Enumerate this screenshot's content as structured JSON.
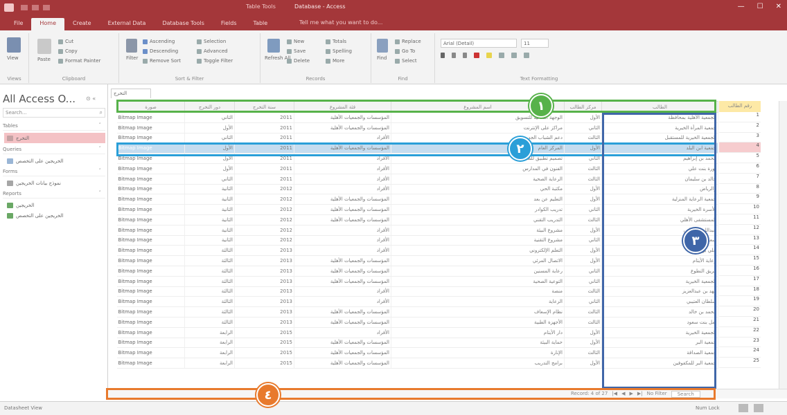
{
  "window": {
    "context_tab_group": "Table Tools",
    "title": "Database - Access",
    "minimize_glyph": "—",
    "maximize_glyph": "☐",
    "close_glyph": "✕"
  },
  "ribbon_tabs": [
    "File",
    "Home",
    "Create",
    "External Data",
    "Database Tools",
    "Fields",
    "Table"
  ],
  "tell_me": "Tell me what you want to do...",
  "ribbon": {
    "views": {
      "view": "View",
      "group": "Views"
    },
    "clipboard": {
      "paste": "Paste",
      "cut": "Cut",
      "copy": "Copy",
      "format_painter": "Format Painter",
      "group": "Clipboard"
    },
    "sort_filter": {
      "filter": "Filter",
      "ascending": "Ascending",
      "descending": "Descending",
      "remove_sort": "Remove Sort",
      "selection": "Selection",
      "advanced": "Advanced",
      "toggle_filter": "Toggle Filter",
      "group": "Sort & Filter"
    },
    "records": {
      "refresh": "Refresh All",
      "new": "New",
      "save": "Save",
      "delete": "Delete",
      "totals": "Totals",
      "spelling": "Spelling",
      "more": "More",
      "group": "Records"
    },
    "find": {
      "find": "Find",
      "replace": "Replace",
      "go_to": "Go To",
      "select": "Select",
      "group": "Find"
    },
    "text_formatting": {
      "font": "Arial (Detail)",
      "size": "11",
      "group": "Text Formatting"
    }
  },
  "nav": {
    "title": "All Access O...",
    "search_placeholder": "Search...",
    "sections": [
      {
        "label": "Tables",
        "items": [
          "التخرج"
        ]
      },
      {
        "label": "Queries",
        "items": [
          "الخريجين على التخصص"
        ]
      },
      {
        "label": "Forms",
        "items": [
          "نموذج بيانات الخريجين"
        ]
      },
      {
        "label": "Reports",
        "items": [
          "الخريجين",
          "الخريجين على التخصص"
        ]
      }
    ]
  },
  "document_tab": "التخرج",
  "table": {
    "headers": [
      "صورة",
      "دور التخرج",
      "سنة التخرج",
      "فئة المشروع",
      "اسم المشروع",
      "مركز الطالب",
      "الطالب"
    ],
    "image_label": "Bitmap Image",
    "rows": [
      [
        "الثاني",
        "2011",
        "المؤسسات والجمعيات الأهلية",
        "الوجهة المثالية للتسويق",
        "الأول",
        "الجمعية الأهلية بمحافظة"
      ],
      [
        "الأول",
        "2011",
        "المؤسسات والجمعيات الأهلية",
        "مراكز على الإنترنت",
        "الثاني",
        "جمعية المرأة الخيرية"
      ],
      [
        "الثاني",
        "2011",
        "الأفراد",
        "دعم الشباب الجديد",
        "الثالث",
        "الجمعية الخيرية للمستقبل"
      ],
      [
        "الأول",
        "2011",
        "المؤسسات والجمعيات الأهلية",
        "المركز العام",
        "الأول",
        "جمعية ابن البلد"
      ],
      [
        "الأول",
        "2011",
        "الأفراد",
        "تصميم تطبيق للمدرسة",
        "الثاني",
        "محمد بن إبراهيم"
      ],
      [
        "الأول",
        "2011",
        "الأفراد",
        "الفنون في المدارس",
        "الثالث",
        "نورة بنت علي"
      ],
      [
        "الثاني",
        "2011",
        "الأفراد",
        "الرعاية الصحية",
        "الثالث",
        "خالد بن سليمان"
      ],
      [
        "الثانية",
        "2012",
        "الأفراد",
        "مكتبة الحي",
        "الأول",
        "والرياض"
      ],
      [
        "الثانية",
        "2012",
        "المؤسسات والجمعيات الأهلية",
        "التعليم عن بعد",
        "الأول",
        "جمعية الرعاية المنزلية"
      ],
      [
        "الثانية",
        "2012",
        "المؤسسات والجمعيات الأهلية",
        "تدريب الكوادر",
        "الثاني",
        "الأسرة الخيرية"
      ],
      [
        "الثانية",
        "2012",
        "المؤسسات والجمعيات الأهلية",
        "التدريب التقني",
        "الثالث",
        "المستشفى الأهلي"
      ],
      [
        "الثانية",
        "2012",
        "الأفراد",
        "مشروع البيئة",
        "الأول",
        "عبدالله الزهراني"
      ],
      [
        "الثانية",
        "2012",
        "الأفراد",
        "مشروع التقنية",
        "الثاني",
        "سعد بن أحمد"
      ],
      [
        "الثالثة",
        "2013",
        "الأفراد",
        "التعلم الإلكتروني",
        "الأول",
        "علي بن محمد"
      ],
      [
        "الثالثة",
        "2013",
        "المؤسسات والجمعيات الأهلية",
        "الاتصال المرئي",
        "الأول",
        "رعاية الأيتام"
      ],
      [
        "الثالثة",
        "2013",
        "المؤسسات والجمعيات الأهلية",
        "رعاية المسنين",
        "الثاني",
        "فريق التطوع"
      ],
      [
        "الثالثة",
        "2013",
        "المؤسسات والجمعيات الأهلية",
        "التوعية الصحية",
        "الثاني",
        "الجمعية الخيرية"
      ],
      [
        "الثالثة",
        "2013",
        "الأفراد",
        "منصة",
        "الثالث",
        "فهد بن عبدالعزيز"
      ],
      [
        "الثالثة",
        "2013",
        "الأفراد",
        "الرعاية",
        "الثاني",
        "سلطان العتيبي"
      ],
      [
        "الثالثة",
        "2013",
        "المؤسسات والجمعيات الأهلية",
        "نظام الإسعاف",
        "الثالث",
        "محمد بن خالد"
      ],
      [
        "الثالثة",
        "2013",
        "المؤسسات والجمعيات الأهلية",
        "الأجهزة الطبية",
        "الثالث",
        "أمل بنت سعود"
      ],
      [
        "الرابعة",
        "2015",
        "الأفراد",
        "دار الأيتام",
        "الأول",
        "الجمعية الخيرية"
      ],
      [
        "الرابعة",
        "2015",
        "المؤسسات والجمعيات الأهلية",
        "حماية البيئة",
        "الأول",
        "جمعية البر"
      ],
      [
        "الرابعة",
        "2015",
        "المؤسسات والجمعيات الأهلية",
        "الإنارة",
        "الثالث",
        "جمعية الصداقة"
      ],
      [
        "الرابعة",
        "2015",
        "المؤسسات والجمعيات الأهلية",
        "برامج التدريب",
        "الأول",
        "جمعية البر للمكفوفين"
      ]
    ]
  },
  "selection_column": {
    "header": "رقم الطالب",
    "values": [
      "1",
      "2",
      "3",
      "4",
      "5",
      "6",
      "7",
      "8",
      "9",
      "10",
      "11",
      "12",
      "13",
      "14",
      "15",
      "16",
      "17",
      "18",
      "19",
      "20",
      "21",
      "22",
      "23",
      "24",
      "25"
    ]
  },
  "record_nav": {
    "label": "Record: 4 of 27",
    "no_filter": "No Filter",
    "search": "Search"
  },
  "status": {
    "view": "Datasheet View",
    "num_lock": "Num Lock"
  },
  "callouts": {
    "one": "١",
    "two": "٢",
    "three": "٣",
    "four": "٤"
  },
  "colors": {
    "title_bar": "#a4373a",
    "green": "#57b24a",
    "blue": "#2a9fd8",
    "navy": "#3f66a8",
    "orange": "#e87a2d"
  }
}
